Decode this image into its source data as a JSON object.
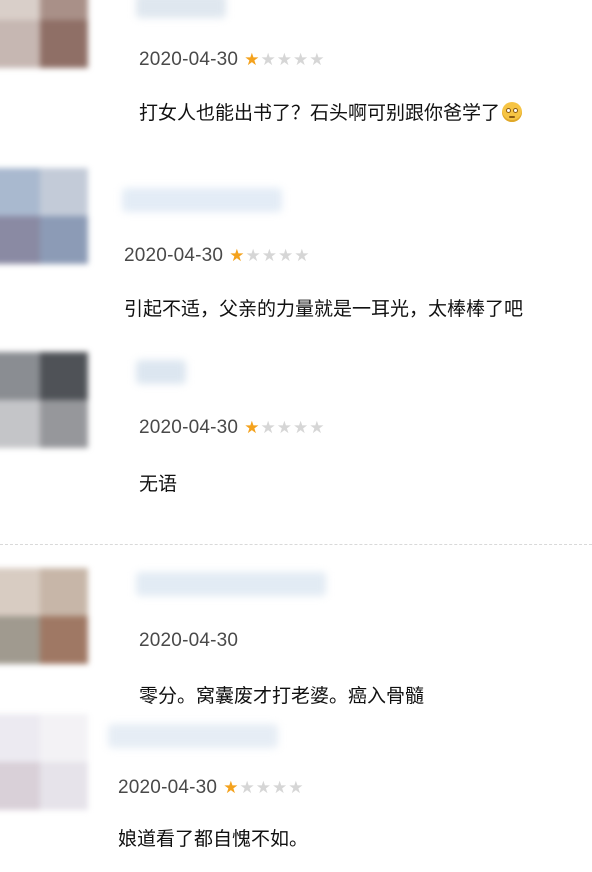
{
  "colors": {
    "star_on": "#f4a21d",
    "star_off": "#d6d6d6",
    "date": "#494949",
    "text": "#111111"
  },
  "comments": [
    {
      "date": "2020-04-30",
      "rating": 1,
      "rating_shown": true,
      "text": "打女人也能出书了？石头啊可别跟你爸学了",
      "trailing_emoji": "face-with-rolling-eyes-icon"
    },
    {
      "date": "2020-04-30",
      "rating": 1,
      "rating_shown": true,
      "text": "引起不适，父亲的力量就是一耳光，太棒棒了吧"
    },
    {
      "date": "2020-04-30",
      "rating": 1,
      "rating_shown": true,
      "text": "无语"
    },
    {
      "date": "2020-04-30",
      "rating_shown": false,
      "text": "零分。窝囊废才打老婆。癌入骨髓"
    },
    {
      "date": "2020-04-30",
      "rating": 1,
      "rating_shown": true,
      "text": "娘道看了都自愧不如。"
    }
  ]
}
